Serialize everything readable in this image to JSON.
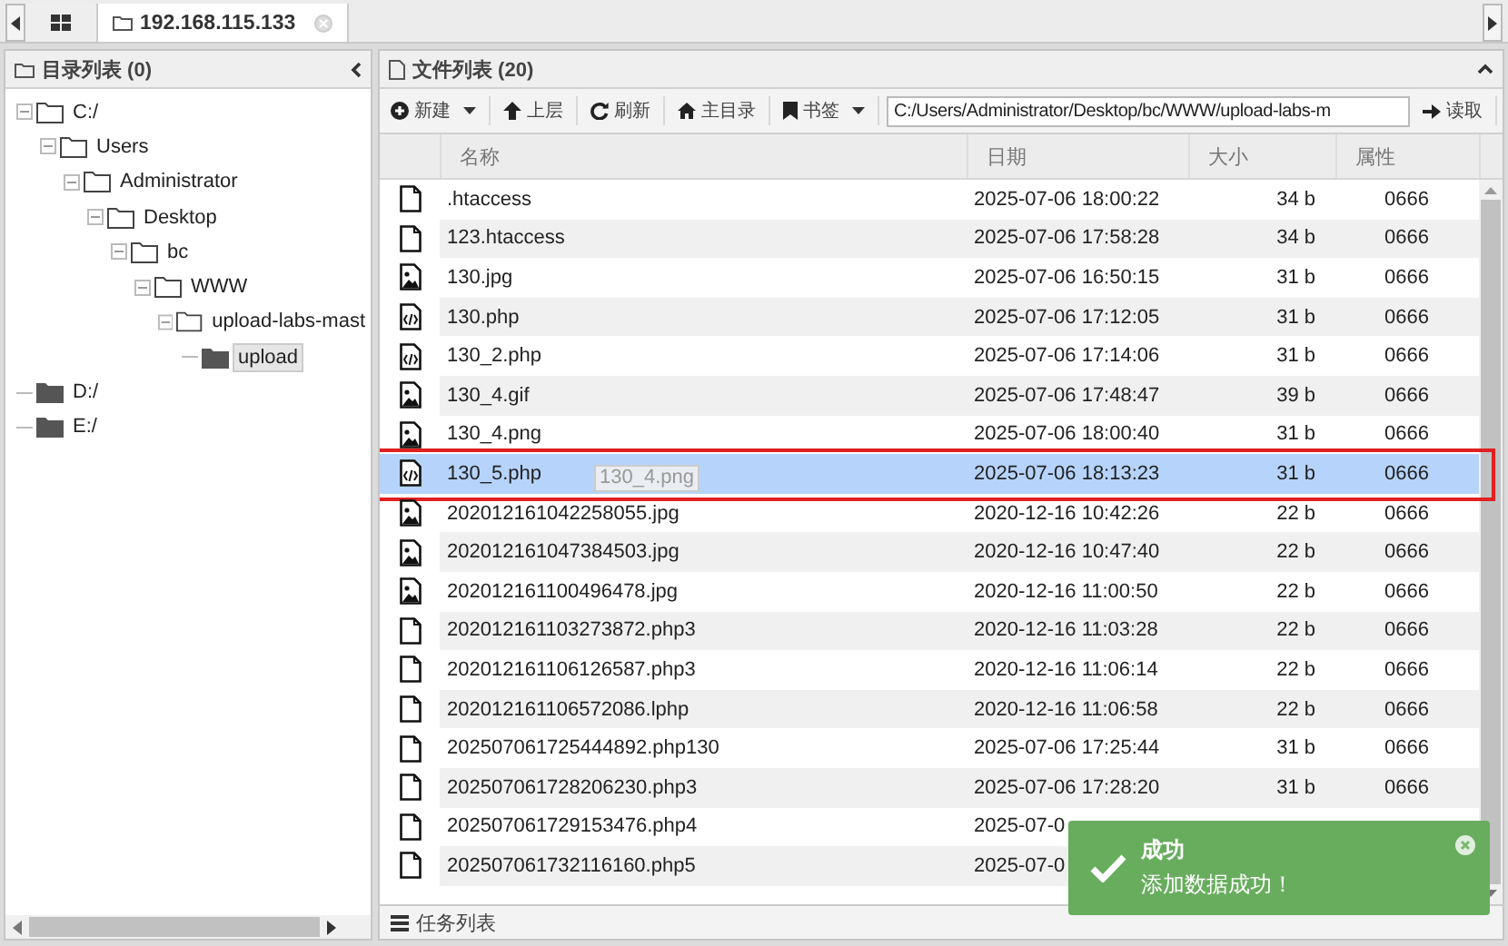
{
  "tabs": [
    {
      "kind": "grid",
      "selected": false
    },
    {
      "kind": "host",
      "label": "192.168.115.133",
      "selected": true
    }
  ],
  "sidebar": {
    "title": "目录列表 (0)",
    "tree": [
      {
        "label": "C:/",
        "expanded": true,
        "selected": false,
        "children": [
          {
            "label": "Users",
            "expanded": true,
            "selected": false,
            "children": [
              {
                "label": "Administrator",
                "expanded": true,
                "selected": false,
                "children": [
                  {
                    "label": "Desktop",
                    "expanded": true,
                    "selected": false,
                    "children": [
                      {
                        "label": "bc",
                        "expanded": true,
                        "selected": false,
                        "children": [
                          {
                            "label": "WWW",
                            "expanded": true,
                            "selected": false,
                            "children": [
                              {
                                "label": "upload-labs-mast",
                                "expanded": true,
                                "selected": false,
                                "children": [
                                  {
                                    "label": "upload",
                                    "expanded": false,
                                    "selected": true
                                  }
                                ]
                              }
                            ]
                          }
                        ]
                      }
                    ]
                  }
                ]
              }
            ]
          }
        ]
      },
      {
        "label": "D:/",
        "expanded": false,
        "selected": false
      },
      {
        "label": "E:/",
        "expanded": false,
        "selected": false
      }
    ]
  },
  "file_panel": {
    "title": "文件列表 (20)",
    "toolbar": [
      {
        "kind": "new",
        "label": "新建",
        "dropdown": true
      },
      {
        "kind": "up",
        "label": "上层",
        "dropdown": false
      },
      {
        "kind": "refresh",
        "label": "刷新",
        "dropdown": false
      },
      {
        "kind": "home",
        "label": "主目录",
        "dropdown": false
      },
      {
        "kind": "bookmark",
        "label": "书签",
        "dropdown": true
      }
    ],
    "path": "C:/Users/Administrator/Desktop/bc/WWW/upload-labs-m",
    "read_button": "读取",
    "columns": [
      "名称",
      "日期",
      "大小",
      "属性"
    ],
    "rows": [
      {
        "kind": "file",
        "name": ".htaccess",
        "date": "2025-07-06 18:00:22",
        "size": "34 b",
        "attr": "0666",
        "selected": false
      },
      {
        "kind": "file",
        "name": "123.htaccess",
        "date": "2025-07-06 17:58:28",
        "size": "34 b",
        "attr": "0666",
        "selected": false
      },
      {
        "kind": "image",
        "name": "130.jpg",
        "date": "2025-07-06 16:50:15",
        "size": "31 b",
        "attr": "0666",
        "selected": false
      },
      {
        "kind": "code",
        "name": "130.php",
        "date": "2025-07-06 17:12:05",
        "size": "31 b",
        "attr": "0666",
        "selected": false
      },
      {
        "kind": "code",
        "name": "130_2.php",
        "date": "2025-07-06 17:14:06",
        "size": "31 b",
        "attr": "0666",
        "selected": false
      },
      {
        "kind": "image",
        "name": "130_4.gif",
        "date": "2025-07-06 17:48:47",
        "size": "39 b",
        "attr": "0666",
        "selected": false
      },
      {
        "kind": "image",
        "name": "130_4.png",
        "date": "2025-07-06 18:00:40",
        "size": "31 b",
        "attr": "0666",
        "selected": false
      },
      {
        "kind": "code",
        "name": "130_5.php",
        "date": "2025-07-06 18:13:23",
        "size": "31 b",
        "attr": "0666",
        "selected": true,
        "annotated": true
      },
      {
        "kind": "image",
        "name": "202012161042258055.jpg",
        "date": "2020-12-16 10:42:26",
        "size": "22 b",
        "attr": "0666",
        "selected": false
      },
      {
        "kind": "image",
        "name": "202012161047384503.jpg",
        "date": "2020-12-16 10:47:40",
        "size": "22 b",
        "attr": "0666",
        "selected": false
      },
      {
        "kind": "image",
        "name": "202012161100496478.jpg",
        "date": "2020-12-16 11:00:50",
        "size": "22 b",
        "attr": "0666",
        "selected": false
      },
      {
        "kind": "file",
        "name": "202012161103273872.php3",
        "date": "2020-12-16 11:03:28",
        "size": "22 b",
        "attr": "0666",
        "selected": false
      },
      {
        "kind": "file",
        "name": "202012161106126587.php3",
        "date": "2020-12-16 11:06:14",
        "size": "22 b",
        "attr": "0666",
        "selected": false
      },
      {
        "kind": "file",
        "name": "202012161106572086.lphp",
        "date": "2020-12-16 11:06:58",
        "size": "22 b",
        "attr": "0666",
        "selected": false
      },
      {
        "kind": "file",
        "name": "202507061725444892.php130",
        "date": "2025-07-06 17:25:44",
        "size": "31 b",
        "attr": "0666",
        "selected": false
      },
      {
        "kind": "file",
        "name": "202507061728206230.php3",
        "date": "2025-07-06 17:28:20",
        "size": "31 b",
        "attr": "0666",
        "selected": false
      },
      {
        "kind": "file",
        "name": "202507061729153476.php4",
        "date": "2025-07-0",
        "selected": false
      },
      {
        "kind": "file",
        "name": "202507061732116160.php5",
        "date": "2025-07-0",
        "selected": false
      }
    ],
    "drag_label": "130_4.png"
  },
  "task_bar": {
    "title": "任务列表"
  },
  "toast": {
    "title": "成功",
    "message": "添加数据成功！"
  }
}
